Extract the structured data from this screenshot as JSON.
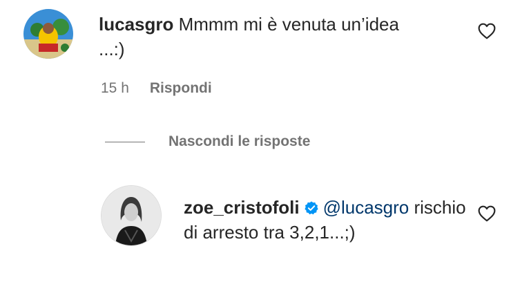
{
  "comment": {
    "username": "lucasgro",
    "text": "Mmmm mi è venuta un’idea ...:)",
    "time": "15 h",
    "reply_label": "Rispondi"
  },
  "replies_toggle": {
    "label": "Nascondi le risposte"
  },
  "reply": {
    "username": "zoe_cristofoli",
    "mention": "@lucasgro",
    "text": "rischio di arresto tra 3,2,1...;)"
  },
  "colors": {
    "text": "#262626",
    "muted": "#737373",
    "mention": "#00376b",
    "verified": "#0095f6"
  },
  "icons": {
    "like": "heart-outline-icon",
    "verified": "verified-badge-icon"
  }
}
